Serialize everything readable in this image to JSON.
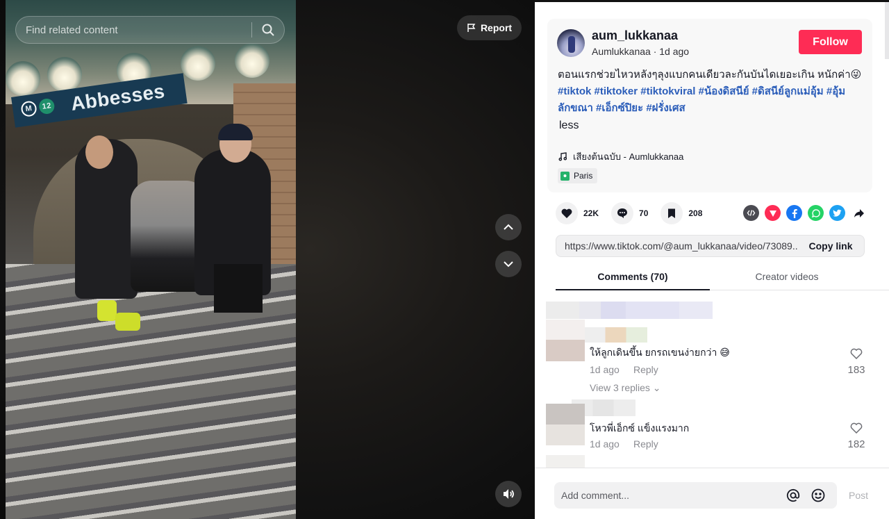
{
  "search": {
    "placeholder": "Find related content"
  },
  "video": {
    "report_label": "Report",
    "scene_sign": {
      "station": "Abbesses",
      "metro_letter": "M",
      "line_number": "12"
    }
  },
  "author": {
    "username": "aum_lukkanaa",
    "nickname_line": "Aumlukkanaa · 1d ago",
    "follow_label": "Follow"
  },
  "description": {
    "text": "ตอนแรกช่วยไหวหลังๆลุงแบกคนเดียวละกันบันไดเยอะเกิน หนักค่า😜 ",
    "hashtags": [
      "#tiktok",
      "#tiktoker",
      "#tiktokviral",
      "#น้องดิสนีย์",
      "#ดิสนีย์ลูกแม่อุ้ม",
      "#อุ้มลักขณา",
      "#เอ็กซ์ปิยะ",
      "#ฝรั่งเศส"
    ],
    "less_label": "less"
  },
  "music": {
    "label": "เสียงต้นฉบับ - Aumlukkanaa",
    "icon": "music-note-icon"
  },
  "location": {
    "label": "Paris"
  },
  "stats": {
    "likes": "22K",
    "comments": "70",
    "saves": "208"
  },
  "share_colors": {
    "embed": "#4b4b52",
    "send": "#fe2c55",
    "facebook": "#1877f2",
    "whatsapp": "#25d366",
    "twitter": "#1da1f2"
  },
  "link": {
    "url": "https://www.tiktok.com/@aum_lukkanaa/video/73089...",
    "copy_label": "Copy link"
  },
  "tabs": {
    "comments": "Comments (70)",
    "creator_videos": "Creator videos"
  },
  "comments": [
    {
      "text": "ให้ลูกเดินขึ้น ยกรถเขนง่ายกว่า 😅",
      "time": "1d ago",
      "reply": "Reply",
      "likes": "183",
      "view_replies": "View 3 replies ⌄"
    },
    {
      "text": "โหวพี่เอ็กซ์ แข็งแรงมาก",
      "time": "1d ago",
      "reply": "Reply",
      "likes": "182"
    }
  ],
  "composer": {
    "placeholder": "Add comment...",
    "post_label": "Post"
  },
  "colors": {
    "brand_red": "#fe2c55",
    "hashtag_blue": "#2b5db9"
  }
}
